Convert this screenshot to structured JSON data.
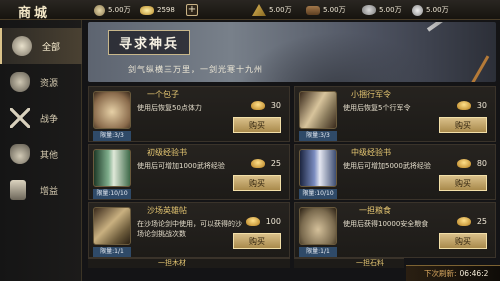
{
  "topbar": {
    "title": "商城",
    "resources": [
      {
        "icon": "coin-icon",
        "value": "5.00万"
      },
      {
        "icon": "ingot-icon",
        "value": "2598"
      },
      {
        "icon": "grain-icon",
        "value": "5.00万"
      },
      {
        "icon": "wood-icon",
        "value": "5.00万"
      },
      {
        "icon": "ore-icon",
        "value": "5.00万"
      }
    ],
    "plus_label": "+"
  },
  "sidebar": {
    "items": [
      {
        "label": "全部",
        "icon": "coins-icon",
        "active": true
      },
      {
        "label": "资源",
        "icon": "grain-bag-icon"
      },
      {
        "label": "战争",
        "icon": "crossed-swords-icon"
      },
      {
        "label": "其他",
        "icon": "bag-icon"
      },
      {
        "label": "增益",
        "icon": "scroll-icon"
      }
    ]
  },
  "banner": {
    "title": "寻求神兵",
    "subtitle": "剑气纵横三万里，一剑光寒十九州"
  },
  "items": [
    {
      "name": "一个包子",
      "desc": "使用后恢复50点体力",
      "price": "30",
      "limit": "限量:3/3",
      "buy": "购买",
      "thumb_color": "#8a6b4c"
    },
    {
      "name": "小捆行军令",
      "desc": "使用后恢复5个行军令",
      "price": "30",
      "limit": "限量:3/3",
      "buy": "购买",
      "thumb_color": "#8a7b5c"
    },
    {
      "name": "初级经验书",
      "desc": "使用后可增加1000武将经验",
      "price": "25",
      "limit": "限量:10/10",
      "buy": "购买",
      "thumb_color": "#3f6b4a"
    },
    {
      "name": "中级经验书",
      "desc": "使用后可增加5000武将经验",
      "price": "80",
      "limit": "限量:10/10",
      "buy": "购买",
      "thumb_color": "#3d4d72"
    },
    {
      "name": "沙场英雄帖",
      "desc": "在沙场论剑中使用，可以获得的沙场论剑挑战次数",
      "price": "100",
      "limit": "限量:1/1",
      "buy": "购买",
      "thumb_color": "#6b5a3a"
    },
    {
      "name": "一担粮食",
      "desc": "使用后获得10000安全粮食",
      "price": "25",
      "limit": "限量:1/1",
      "buy": "购买",
      "thumb_color": "#7a6a4e"
    }
  ],
  "peek": [
    "一担木材",
    "一担石料"
  ],
  "refresh": {
    "label": "下次刷新:",
    "time": "06:46:2"
  },
  "colors": {
    "accent": "#d9c28a",
    "name_gold": "#e7c873",
    "limit_blue": "#2f4a68"
  }
}
